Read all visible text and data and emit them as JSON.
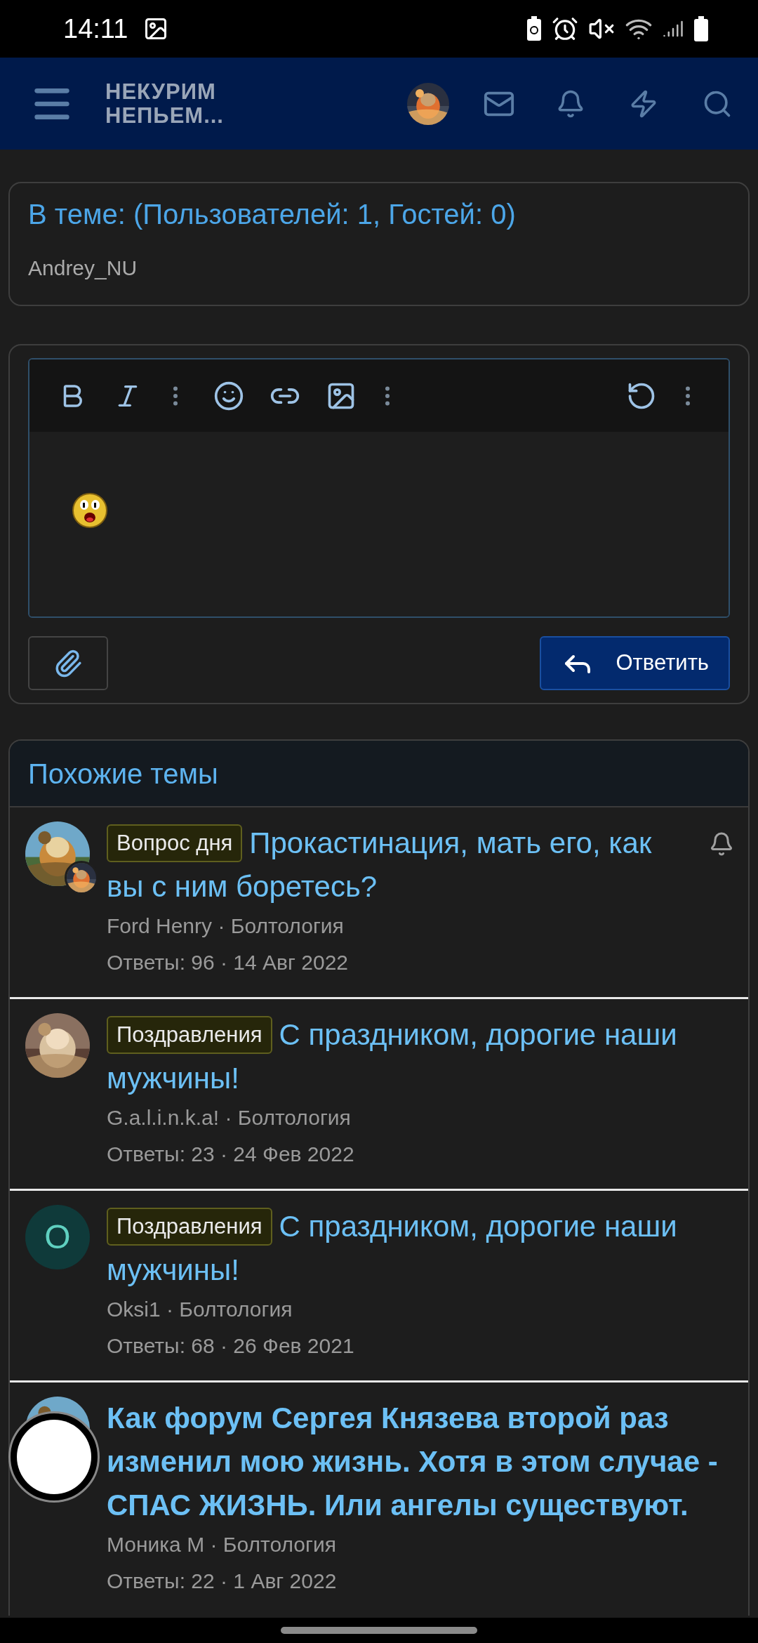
{
  "status_bar": {
    "time": "14:11"
  },
  "header": {
    "logo_lines": [
      "НЕКУРИМ",
      "НЕПЬЕМ..."
    ]
  },
  "online_card": {
    "title": "В теме: (Пользователей: 1, Гостей: 0)",
    "users": [
      "Andrey_NU"
    ]
  },
  "editor": {
    "reply_button": "Ответить"
  },
  "similar": {
    "title": "Похожие темы",
    "threads": [
      {
        "avatar": {
          "kind": "picture_pair"
        },
        "prefix": "Вопрос дня",
        "title": "Прокастинация, мать его, как вы с ним боретесь?",
        "bold": false,
        "watched": true,
        "meta": "Ford Henry · Болтология",
        "stats": "Ответы: 96 · 14 Авг 2022"
      },
      {
        "prefix": "Поздравления",
        "title": "С праздником, дорогие наши мужчины!",
        "bold": false,
        "watched": false,
        "meta": "G.a.l.i.n.k.a! · Болтология",
        "stats": "Ответы: 23 · 24 Фев 2022"
      },
      {
        "avatar": {
          "kind": "letter",
          "letter": "O"
        },
        "prefix": "Поздравления",
        "title": "С праздником, дорогие наши мужчины!",
        "bold": false,
        "watched": false,
        "meta": "Oksi1 · Болтология",
        "stats": "Ответы: 68 · 26 Фев 2021"
      },
      {
        "title": "Как форум Сергея Князева второй раз изменил мою жизнь. Хотя в этом случае - СПАС ЖИЗНЬ. Или ангелы существуют.",
        "bold": true,
        "watched": false,
        "meta": "Моника М · Болтология",
        "stats": "Ответы: 22 · 1 Авг 2022"
      }
    ]
  }
}
